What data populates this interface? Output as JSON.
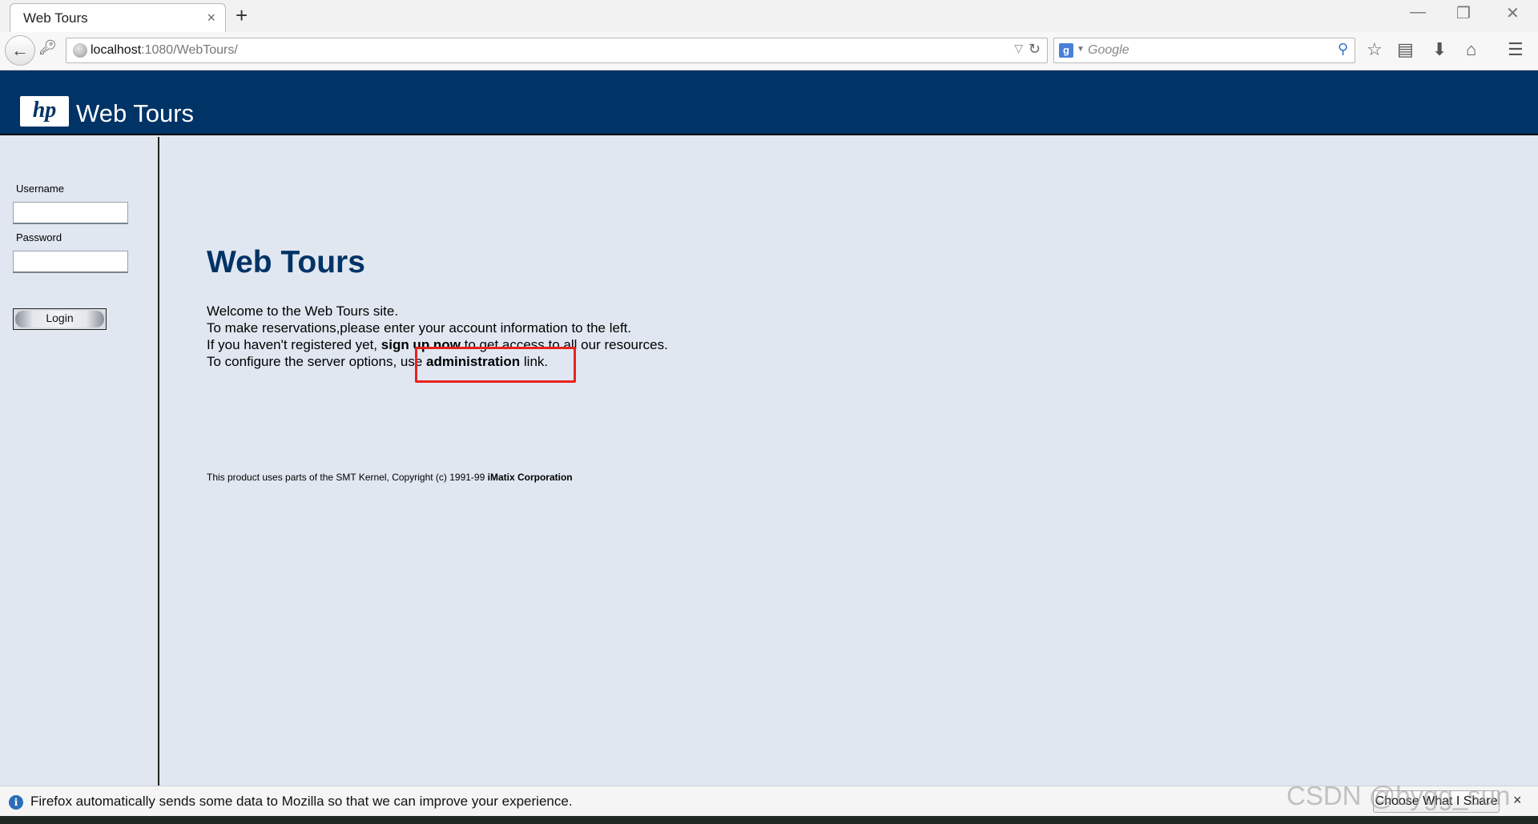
{
  "browser": {
    "tab_title": "Web Tours",
    "tab_close": "×",
    "new_tab": "+",
    "window_controls": {
      "minimize": "—",
      "restore": "❐",
      "close": "✕"
    },
    "url_host": "localhost",
    "url_path": ":1080/WebTours/",
    "search_placeholder": "Google",
    "search_engine_letter": "g",
    "icons": [
      "back-arrow-icon",
      "key-icon",
      "globe-icon",
      "reload-icon",
      "search-icon",
      "star-icon",
      "reading-list-icon",
      "download-icon",
      "home-icon",
      "menu-icon"
    ]
  },
  "header": {
    "logo_text": "hp",
    "brand": "Web Tours"
  },
  "login": {
    "username_label": "Username",
    "password_label": "Password",
    "button_label": "Login"
  },
  "main": {
    "title": "Web Tours",
    "line1": "Welcome to the Web Tours site.",
    "line2": "To make reservations,please enter your account information to the left.",
    "line3_pre": "If you haven't registered yet, ",
    "line3_link": "sign up now",
    "line3_post": " to get access to all our resources.",
    "line4_pre": "To configure the server options, use ",
    "line4_link": "administration",
    "line4_post": " link.",
    "footer_pre": "This product uses parts of the SMT Kernel, Copyright (c) 1991-99 ",
    "footer_bold": "iMatix Corporation"
  },
  "notification": {
    "text": "Firefox automatically sends some data to Mozilla so that we can improve your experience.",
    "button": "Choose What I Share",
    "close": "×"
  },
  "watermark": "CSDN @bygg_sun",
  "colors": {
    "header_bg": "#003366",
    "page_bg": "#e1e7f1",
    "highlight": "#e8231e"
  }
}
